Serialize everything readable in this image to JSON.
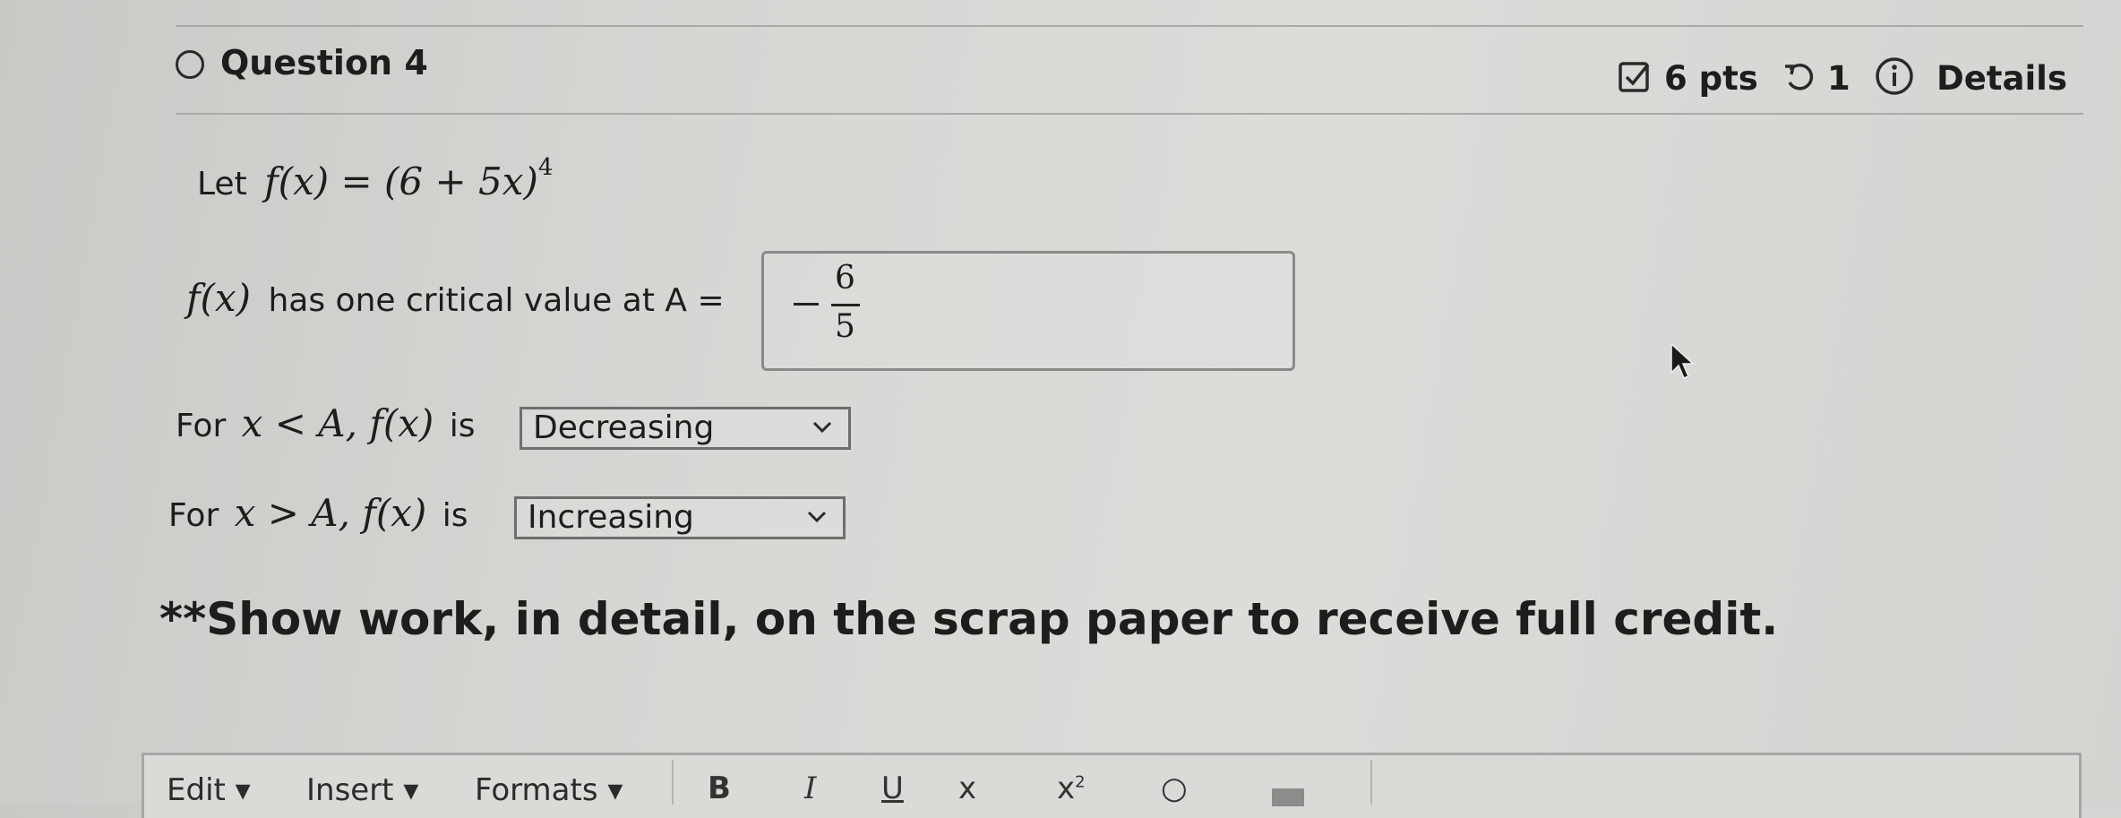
{
  "question": {
    "title": "Question 4",
    "points": "6 pts",
    "attempts": "1",
    "details_label": "Details"
  },
  "problem": {
    "let_label": "Let",
    "function_expr": "f(x) = (6 + 5x)",
    "exponent": "4",
    "fx_label": "f(x)",
    "critical_text": "has one critical value at A =",
    "answer_numerator": "6",
    "answer_denominator": "5",
    "for_label": "For",
    "left_condition": "x < A, f(x)",
    "right_condition": "x > A, f(x)",
    "is_label": "is",
    "left_select_value": "Decreasing",
    "right_select_value": "Increasing"
  },
  "note": "**Show work, in detail, on the scrap paper to receive full credit.",
  "editor_toolbar": {
    "edit_label": "Edit",
    "insert_label": "Insert",
    "formats_label": "Formats",
    "bold_label": "B",
    "italic_label": "I",
    "underline_label": "U"
  },
  "icons": [
    "circle-icon",
    "checkbox-icon",
    "retry-icon",
    "info-icon",
    "chevron-down-icon",
    "mouse-cursor-icon"
  ]
}
